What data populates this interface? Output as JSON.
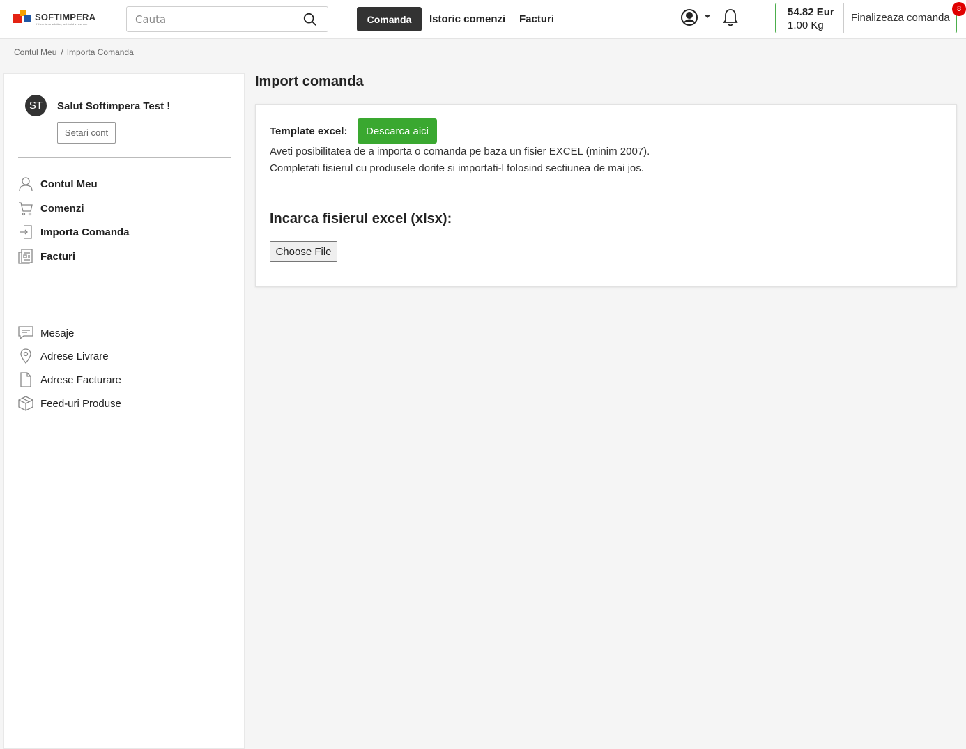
{
  "header": {
    "logo_text": "SOFTIMPERA",
    "logo_tagline": "If there is no solution, just build a new one",
    "search_placeholder": "Cauta",
    "nav": [
      "Comanda",
      "Istoric comenzi",
      "Facturi"
    ],
    "cart_price": "54.82 Eur",
    "cart_weight": "1.00 Kg",
    "finalize_label": "Finalizeaza comanda",
    "cart_badge": "8"
  },
  "breadcrumb": [
    "Contul Meu",
    "Importa Comanda"
  ],
  "sidebar": {
    "avatar_initials": "ST",
    "greeting": "Salut Softimpera Test !",
    "settings_button": "Setari cont",
    "primary_menu": [
      {
        "label": "Contul Meu",
        "icon": "user-icon"
      },
      {
        "label": "Comenzi",
        "icon": "cart-icon"
      },
      {
        "label": "Importa Comanda",
        "icon": "import-icon"
      },
      {
        "label": "Facturi",
        "icon": "invoice-icon"
      }
    ],
    "secondary_menu": [
      {
        "label": "Mesaje",
        "icon": "message-icon"
      },
      {
        "label": "Adrese Livrare",
        "icon": "location-icon"
      },
      {
        "label": "Adrese Facturare",
        "icon": "document-icon"
      },
      {
        "label": "Feed-uri Produse",
        "icon": "box-icon"
      }
    ]
  },
  "main": {
    "title": "Import comanda",
    "template_label": "Template excel:",
    "download_button": "Descarca aici",
    "description_1": "Aveti posibilitatea de a importa o comanda pe baza un fisier EXCEL (minim 2007).",
    "description_2": "Completati fisierul cu produsele dorite si importati-l folosind sectiunea de mai jos.",
    "upload_title": "Incarca fisierul excel (xlsx):",
    "file_button": "Choose File"
  },
  "colors": {
    "accent_dark": "#333333",
    "download_green": "#3aa830",
    "cart_border": "#4cae4c",
    "badge_red": "#e00000"
  }
}
